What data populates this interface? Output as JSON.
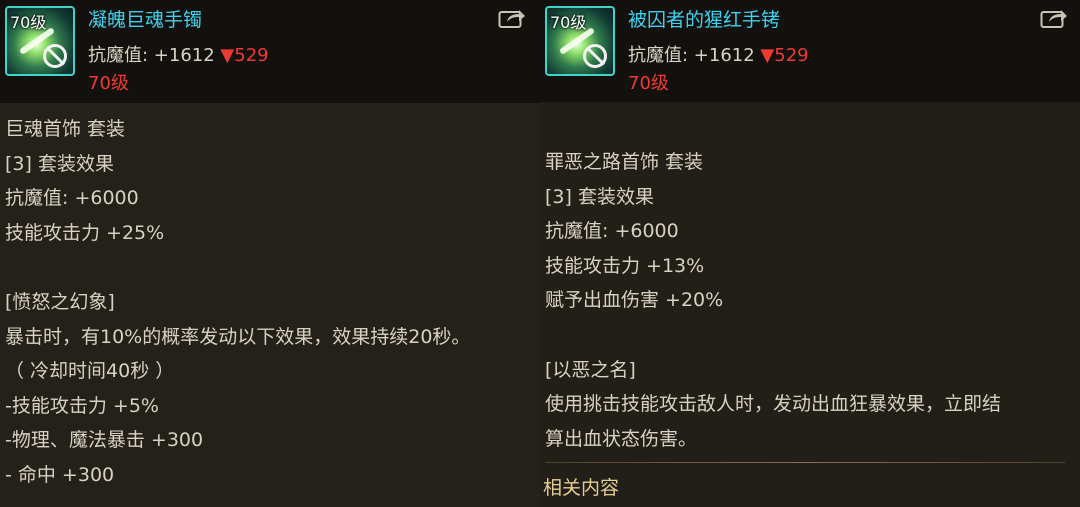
{
  "left_item": {
    "level_badge": "70级",
    "name": "凝魄巨魂手镯",
    "stat_label": "抗魔值: +1612",
    "stat_down": "▼529",
    "level_req": "70级",
    "lines": [
      "巨魂首饰 套装",
      "[3] 套装效果",
      "抗魔值: +6000",
      "技能攻击力 +25%",
      "",
      "[愤怒之幻象]",
      "暴击时，有10%的概率发动以下效果，效果持续20秒。",
      "（ 冷却时间40秒 ）",
      "-技能攻击力 +5%",
      "-物理、魔法暴击 +300",
      "- 命中 +300"
    ]
  },
  "right_item": {
    "level_badge": "70级",
    "name": "被囚者的猩红手铐",
    "stat_label": "抗魔值: +1612",
    "stat_down": "▼529",
    "level_req": "70级",
    "lines": [
      "罪恶之路首饰 套装",
      "[3] 套装效果",
      "抗魔值: +6000",
      "技能攻击力 +13%",
      "赋予出血伤害 +20%",
      "",
      "[以恶之名]",
      "使用挑击技能攻击敌人时，发动出血狂暴效果，立即结",
      "算出血状态伤害。"
    ],
    "related_label": "相关内容"
  },
  "colors": {
    "item_name": "#3fd1f0",
    "stat_down": "#f03a33",
    "level_req": "#f03a33",
    "related": "#e5cf8f",
    "icon_border": "#3fd6c9"
  },
  "icons": {
    "share": "share-icon",
    "unusable": "prohibited-icon"
  }
}
